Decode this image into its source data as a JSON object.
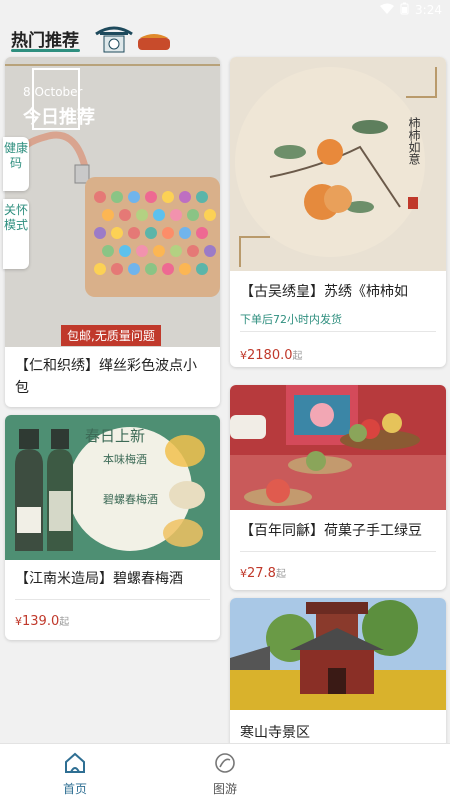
{
  "status": {
    "time": "3:24"
  },
  "header": {
    "title": "热门推荐"
  },
  "side_tabs": {
    "health": "健康码",
    "care": "关怀模式"
  },
  "cards": [
    {
      "promo_date": "8 October",
      "promo_title": "今日推荐",
      "badge": "包邮,无质量问题",
      "title": "【仁和织绣】缂丝彩色波点小包"
    },
    {
      "title": "【古吴绣皇】苏绣《柿柿如",
      "note": "下单后72小时内发货",
      "price_symbol": "¥",
      "price": "2180.0",
      "price_suffix": "起"
    },
    {
      "title": "【百年同龢】荷菓子手工绿豆",
      "price_symbol": "¥",
      "price": "27.8",
      "price_suffix": "起"
    },
    {
      "poster_heading": "春日上新",
      "poster_item1": "本味梅酒",
      "poster_item2": "碧螺春梅酒",
      "title": "【江南米造局】碧螺春梅酒",
      "price_symbol": "¥",
      "price": "139.0",
      "price_suffix": "起"
    },
    {
      "title": "寒山寺景区"
    }
  ],
  "nav": {
    "home": "首页",
    "tour": "图游"
  },
  "colors": {
    "accent": "#2f8f7f",
    "price": "#c0392b",
    "badge": "#c0392b"
  }
}
